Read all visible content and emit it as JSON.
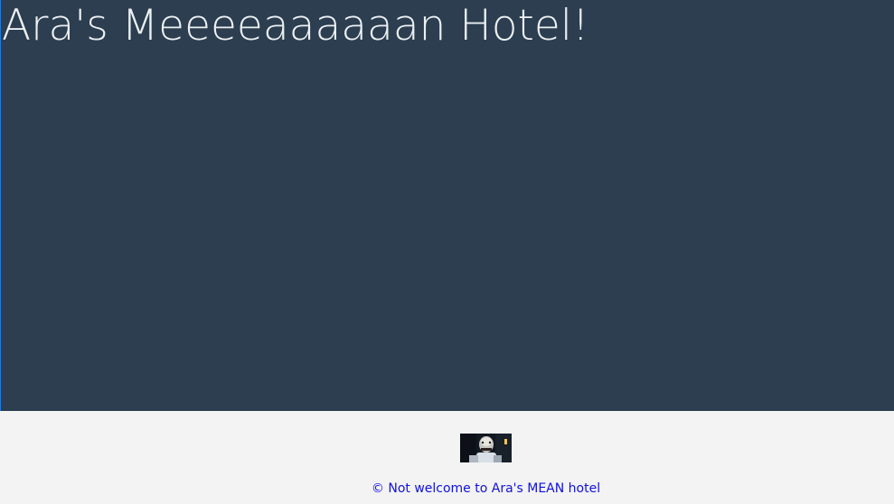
{
  "hero": {
    "title": "Ara's Meeeeaaaaaan Hotel!"
  },
  "footer": {
    "avatar_icon": "portrait-photo-icon",
    "text": "© Not welcome to Ara's MEAN hotel"
  },
  "colors": {
    "hero_background": "#2c3e50",
    "hero_text": "#ecf0f3",
    "footer_background": "#f3f3f3",
    "footer_text": "#1111dd"
  }
}
